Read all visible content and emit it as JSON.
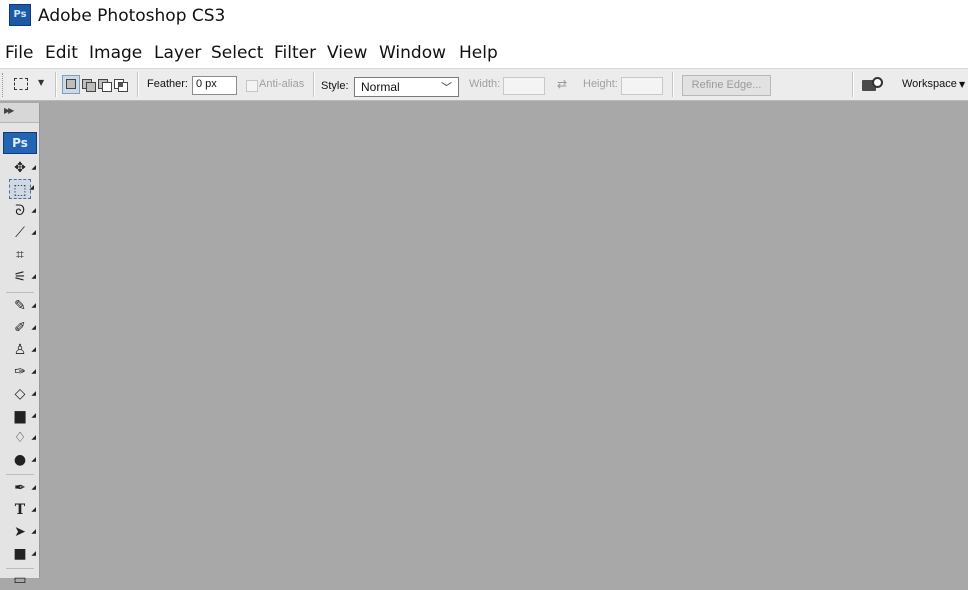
{
  "window": {
    "title": "Adobe Photoshop CS3",
    "app_icon": "Ps"
  },
  "menu": [
    "File",
    "Edit",
    "Image",
    "Layer",
    "Select",
    "Filter",
    "View",
    "Window",
    "Help"
  ],
  "options": {
    "feather_label": "Feather:",
    "feather_value": "0 px",
    "antialias_label": "Anti-alias",
    "style_label": "Style:",
    "style_value": "Normal",
    "width_label": "Width:",
    "width_value": "",
    "height_label": "Height:",
    "height_value": "",
    "refine_edge_label": "Refine Edge...",
    "workspace_label": "Workspace"
  },
  "toolbox": {
    "badge": "Ps",
    "tools": [
      {
        "name": "move-tool",
        "glyph": "✥"
      },
      {
        "name": "rectangular-marquee-tool",
        "glyph": "⬚",
        "active": true
      },
      {
        "name": "lasso-tool",
        "glyph": "ᘐ"
      },
      {
        "name": "quick-selection-tool",
        "glyph": "⟋"
      },
      {
        "name": "crop-tool",
        "glyph": "⌗"
      },
      {
        "name": "slice-tool",
        "glyph": "⚟"
      },
      {
        "name": "healing-brush-tool",
        "glyph": "✎"
      },
      {
        "name": "brush-tool",
        "glyph": "✐"
      },
      {
        "name": "clone-stamp-tool",
        "glyph": "♙"
      },
      {
        "name": "history-brush-tool",
        "glyph": "✑"
      },
      {
        "name": "eraser-tool",
        "glyph": "◇"
      },
      {
        "name": "gradient-tool",
        "glyph": "▆"
      },
      {
        "name": "blur-tool",
        "glyph": "💧"
      },
      {
        "name": "dodge-tool",
        "glyph": "●"
      },
      {
        "name": "pen-tool",
        "glyph": "✒"
      },
      {
        "name": "type-tool",
        "glyph": "T"
      },
      {
        "name": "path-selection-tool",
        "glyph": "➤"
      },
      {
        "name": "rectangle-tool",
        "glyph": "■"
      },
      {
        "name": "notes-tool",
        "glyph": "▭"
      }
    ]
  },
  "colors": {
    "workspace": "#a8a8a8",
    "toolbox": "#e4e4e4",
    "optionsbar": "#ececec",
    "ps_blue": "#2465b3"
  }
}
